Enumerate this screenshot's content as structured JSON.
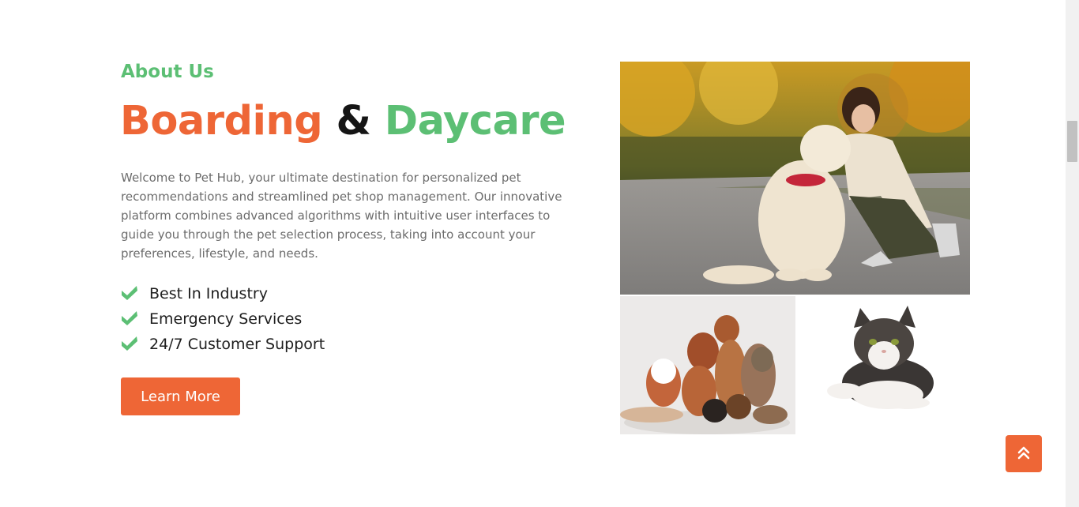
{
  "about": {
    "label": "About Us",
    "headline": {
      "word1": "Boarding",
      "word2": "&",
      "word3": "Daycare"
    },
    "intro": "Welcome to Pet Hub, your ultimate destination for personalized pet recommendations and streamlined pet shop management. Our innovative platform combines advanced algorithms with intuitive user interfaces to guide you through the pet selection process, taking into account your preferences, lifestyle, and needs.",
    "features": [
      {
        "label": "Best In Industry",
        "icon": "check-icon"
      },
      {
        "label": "Emergency Services",
        "icon": "check-icon"
      },
      {
        "label": "24/7 Customer Support",
        "icon": "check-icon"
      }
    ],
    "cta_label": "Learn More"
  },
  "images": {
    "main": "woman-with-golden-retriever-photo",
    "dogs": "group-of-dogs-photo",
    "cat": "cat-lying-photo"
  },
  "scroll_top": {
    "icon": "double-chevron-up-icon"
  },
  "colors": {
    "accent_orange": "#ee6636",
    "accent_green": "#5cbf74",
    "text_dark": "#151515",
    "text_muted": "#6c6c6c"
  }
}
